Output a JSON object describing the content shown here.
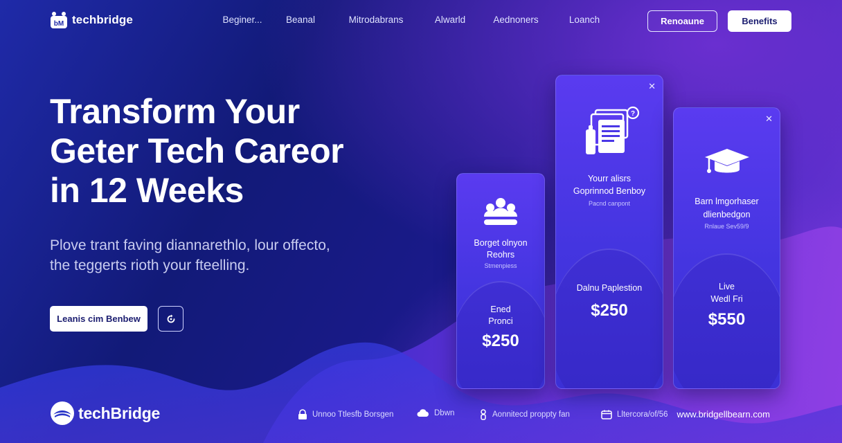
{
  "brand": {
    "name_top": "techbridge",
    "name_footer": "techBridge"
  },
  "nav": {
    "links": [
      "Beginer...",
      "Beanal",
      "Mitrodabrans",
      "Alwarld",
      "Aednoners",
      "Loanch"
    ],
    "outline_button": "Renoaune",
    "solid_button": "Benefits"
  },
  "hero": {
    "title_lines": [
      "Transform Your",
      "Geter Tech Careor",
      "in 12 Weeks"
    ],
    "subtitle_lines": [
      "Plove trant faving diannarethlo, lour offecto,",
      "the teggerts rioth your fteelling."
    ],
    "cta_label": "Leanis cim Benbew"
  },
  "cards": [
    {
      "id": "card1",
      "icon": "teamwork-icon",
      "title_lines": [
        "Borget olnyon",
        "Reohrs"
      ],
      "small": "Stmenpiess",
      "sub_lines": [
        "Ened",
        "Pronci"
      ],
      "price": "$250",
      "has_close": false
    },
    {
      "id": "card2",
      "icon": "documents-icon",
      "title_lines": [
        "Yourr alisrs",
        "Goprinnod Benboy"
      ],
      "small": "Pacnd canpont",
      "sub_lines": [
        "Dalnu Paplestion"
      ],
      "price": "$250",
      "has_close": true
    },
    {
      "id": "card3",
      "icon": "graduation-cap-icon",
      "title_lines": [
        "Barn lmgorhaser",
        "dlienbedgon"
      ],
      "small": "Rnlaue Sev59/9",
      "sub_lines": [
        "Live",
        "Wedl Fri"
      ],
      "price": "$550",
      "has_close": true
    }
  ],
  "footer": {
    "items": [
      {
        "icon": "lock-icon",
        "text": "Unnoo Ttlesfb Borsgen"
      },
      {
        "icon": "cloud-icon",
        "text": "Dbwn"
      },
      {
        "icon": "person-icon",
        "text": "Aonnitecd proppty fan"
      },
      {
        "icon": "calendar-icon",
        "text": "Lltercora/of/56"
      }
    ],
    "email": "www.bridgellbearn.com"
  },
  "colors": {
    "bg_dark": "#141b7a",
    "card": "#4a37e6",
    "accent_purple": "#8a3be0",
    "button_text": "#1b1d70"
  }
}
